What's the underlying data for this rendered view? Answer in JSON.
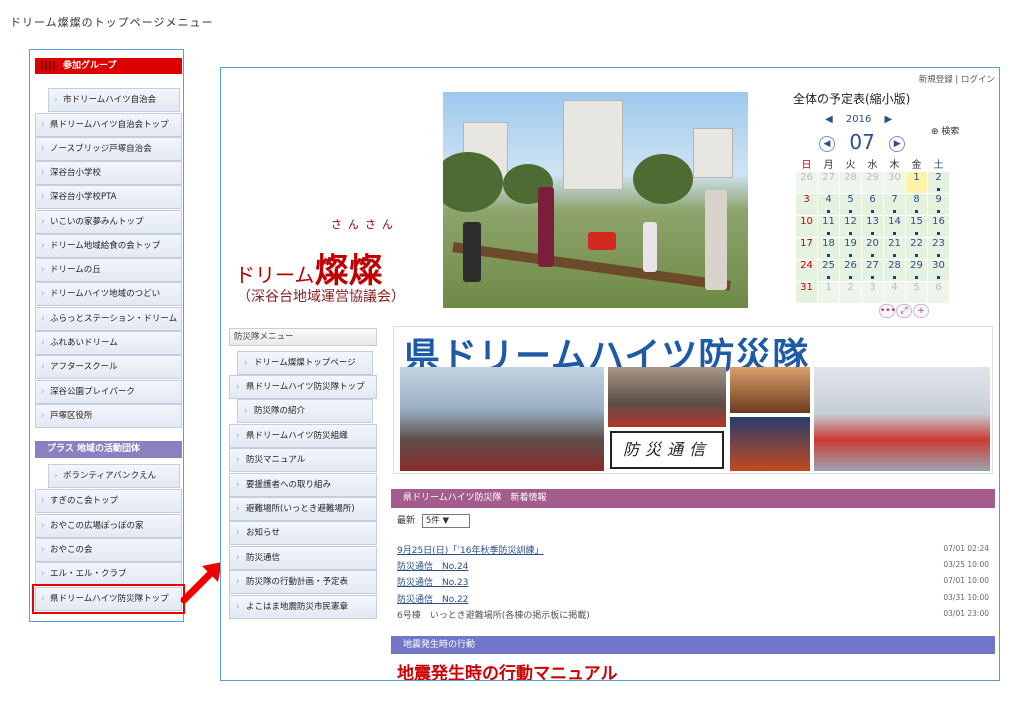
{
  "caption": "ドリーム燦燦のトップページメニュー",
  "left_menu": {
    "group1_title": "参加グループ",
    "items": [
      "市ドリームハイツ自治会",
      "県ドリームハイツ自治会トップ",
      "ノースブリッジ戸塚自治会",
      "深谷台小学校",
      "深谷台小学校PTA",
      "いこいの家夢みんトップ",
      "ドリーム地域給食の会トップ",
      "ドリームの丘",
      "ドリームハイツ地域のつどい",
      "ふらっとステーション・ドリーム",
      "ふれあいドリーム",
      "アフタースクール",
      "深谷公園プレイパーク",
      "戸塚区役所"
    ],
    "group2_title": "プラス 地域の活動団体",
    "items2": [
      "ボランティアバンクえん",
      "すぎのこ会トップ",
      "おやこの広場ぽっぽの家",
      "おやこの会",
      "エル・エル・クラブ",
      "県ドリームハイツ防災隊トップ"
    ]
  },
  "site": {
    "top_links": "新規登録 | ログイン",
    "logo_ruby": "さんさん",
    "logo_prefix": "ドリーム",
    "logo_main": "燦燦",
    "logo_sub": "（深谷台地域運営協議会）",
    "calendar_title": "全体の予定表(縮小版)",
    "search_label": "⊕ 検索",
    "calendar": {
      "year": "2016",
      "month": "07",
      "weekdays": [
        "日",
        "月",
        "火",
        "水",
        "木",
        "金",
        "土"
      ],
      "weeks": [
        [
          "26",
          "27",
          "28",
          "29",
          "30",
          "1",
          "2"
        ],
        [
          "3",
          "4",
          "5",
          "6",
          "7",
          "8",
          "9"
        ],
        [
          "10",
          "11",
          "12",
          "13",
          "14",
          "15",
          "16"
        ],
        [
          "17",
          "18",
          "19",
          "20",
          "21",
          "22",
          "23"
        ],
        [
          "24",
          "25",
          "26",
          "27",
          "28",
          "29",
          "30"
        ],
        [
          "31",
          "1",
          "2",
          "3",
          "4",
          "5",
          "6"
        ]
      ]
    },
    "sub_menu": {
      "title": "防災隊メニュー",
      "items": [
        "ドリーム燦燦トップページ",
        "県ドリームハイツ防災隊トップ",
        "防災隊の紹介",
        "県ドリームハイツ防災組織",
        "防災マニュアル",
        "要援護者への取り組み",
        "避難場所(いっとき避難場所)",
        "お知らせ",
        "防災通信",
        "防災隊の行動計画・予定表",
        "よこはま地震防災市民憲章"
      ]
    },
    "banner_title": "県ドリームハイツ防災隊",
    "banner_caption": "防災通信",
    "news": {
      "header": "県ドリームハイツ防災隊　新着情報",
      "filter_label": "最新",
      "filter_value": "5件",
      "items": [
        {
          "title": "9月25日(日)「’16年秋季防災訓練」",
          "date": "07/01 02:24"
        },
        {
          "title": "防災通信　No.24",
          "date": "03/25 10:00"
        },
        {
          "title": "防災通信　No.23",
          "date": "07/01 10:00"
        },
        {
          "title": "防災通信　No.22",
          "date": "03/31 10:00"
        },
        {
          "title": "6号棟　いっとき避難場所(各棟の掲示板に掲載)",
          "date": "03/01 23:00"
        }
      ]
    },
    "eq_header": "地震発生時の行動",
    "eq_title": "地震発生時の行動マニュアル"
  }
}
